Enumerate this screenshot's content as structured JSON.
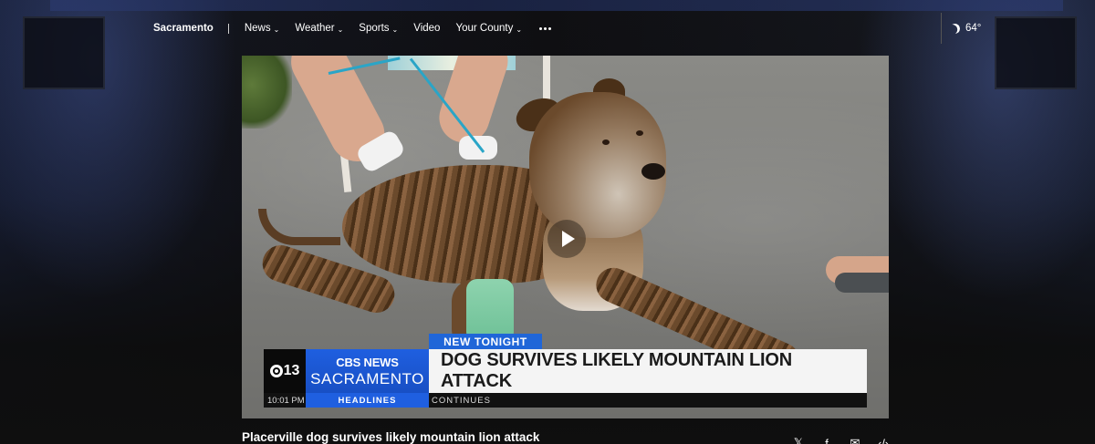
{
  "nav": {
    "brand": "Sacramento",
    "items": [
      {
        "label": "News",
        "has_dropdown": true
      },
      {
        "label": "Weather",
        "has_dropdown": true
      },
      {
        "label": "Sports",
        "has_dropdown": true
      },
      {
        "label": "Video",
        "has_dropdown": false
      },
      {
        "label": "Your County",
        "has_dropdown": true
      }
    ],
    "more_icon": "ellipsis-icon"
  },
  "weather": {
    "icon": "moon-icon",
    "temp": "64°"
  },
  "video": {
    "lower_third": {
      "tag": "NEW TONIGHT",
      "station_line1": "CBS NEWS",
      "station_line2": "SACRAMENTO",
      "channel_logo": "13",
      "headline": "DOG SURVIVES LIKELY MOUNTAIN LION ATTACK",
      "time": "10:01 PM",
      "section": "HEADLINES",
      "ticker": "CONTINUES"
    },
    "play_icon": "play-icon"
  },
  "story": {
    "title": "Placerville dog survives likely mountain lion attack"
  },
  "share": {
    "icons": [
      "x-icon",
      "facebook-icon",
      "email-icon",
      "embed-icon"
    ],
    "glyphs": [
      "𝕏",
      "f",
      "✉",
      "‹/›"
    ]
  },
  "colors": {
    "accent_blue": "#1f5fe0",
    "background": "#0d0d0d"
  }
}
